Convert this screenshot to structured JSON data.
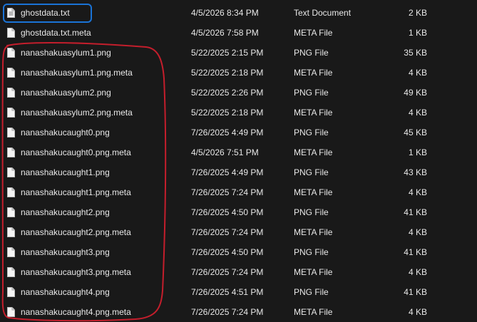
{
  "files": [
    {
      "name": "ghostdata.txt",
      "date": "4/5/2026 8:34 PM",
      "type": "Text Document",
      "size": "2 KB",
      "icon": "text-file-icon"
    },
    {
      "name": "ghostdata.txt.meta",
      "date": "4/5/2026 7:58 PM",
      "type": "META File",
      "size": "1 KB",
      "icon": "file-icon"
    },
    {
      "name": "nanashakuasylum1.png",
      "date": "5/22/2025 2:15 PM",
      "type": "PNG File",
      "size": "35 KB",
      "icon": "file-icon"
    },
    {
      "name": "nanashakuasylum1.png.meta",
      "date": "5/22/2025 2:18 PM",
      "type": "META File",
      "size": "4 KB",
      "icon": "file-icon"
    },
    {
      "name": "nanashakuasylum2.png",
      "date": "5/22/2025 2:26 PM",
      "type": "PNG File",
      "size": "49 KB",
      "icon": "file-icon"
    },
    {
      "name": "nanashakuasylum2.png.meta",
      "date": "5/22/2025 2:18 PM",
      "type": "META File",
      "size": "4 KB",
      "icon": "file-icon"
    },
    {
      "name": "nanashakucaught0.png",
      "date": "7/26/2025 4:49 PM",
      "type": "PNG File",
      "size": "45 KB",
      "icon": "file-icon"
    },
    {
      "name": "nanashakucaught0.png.meta",
      "date": "4/5/2026 7:51 PM",
      "type": "META File",
      "size": "1 KB",
      "icon": "file-icon"
    },
    {
      "name": "nanashakucaught1.png",
      "date": "7/26/2025 4:49 PM",
      "type": "PNG File",
      "size": "43 KB",
      "icon": "file-icon"
    },
    {
      "name": "nanashakucaught1.png.meta",
      "date": "7/26/2025 7:24 PM",
      "type": "META File",
      "size": "4 KB",
      "icon": "file-icon"
    },
    {
      "name": "nanashakucaught2.png",
      "date": "7/26/2025 4:50 PM",
      "type": "PNG File",
      "size": "41 KB",
      "icon": "file-icon"
    },
    {
      "name": "nanashakucaught2.png.meta",
      "date": "7/26/2025 7:24 PM",
      "type": "META File",
      "size": "4 KB",
      "icon": "file-icon"
    },
    {
      "name": "nanashakucaught3.png",
      "date": "7/26/2025 4:50 PM",
      "type": "PNG File",
      "size": "41 KB",
      "icon": "file-icon"
    },
    {
      "name": "nanashakucaught3.png.meta",
      "date": "7/26/2025 7:24 PM",
      "type": "META File",
      "size": "4 KB",
      "icon": "file-icon"
    },
    {
      "name": "nanashakucaught4.png",
      "date": "7/26/2025 4:51 PM",
      "type": "PNG File",
      "size": "41 KB",
      "icon": "file-icon"
    },
    {
      "name": "nanashakucaught4.png.meta",
      "date": "7/26/2025 7:24 PM",
      "type": "META File",
      "size": "4 KB",
      "icon": "file-icon"
    }
  ],
  "colors": {
    "background": "#191919",
    "text": "#e8e8e8",
    "selection_outline": "#1a73d6",
    "annotation_outline": "#c41e2c"
  }
}
